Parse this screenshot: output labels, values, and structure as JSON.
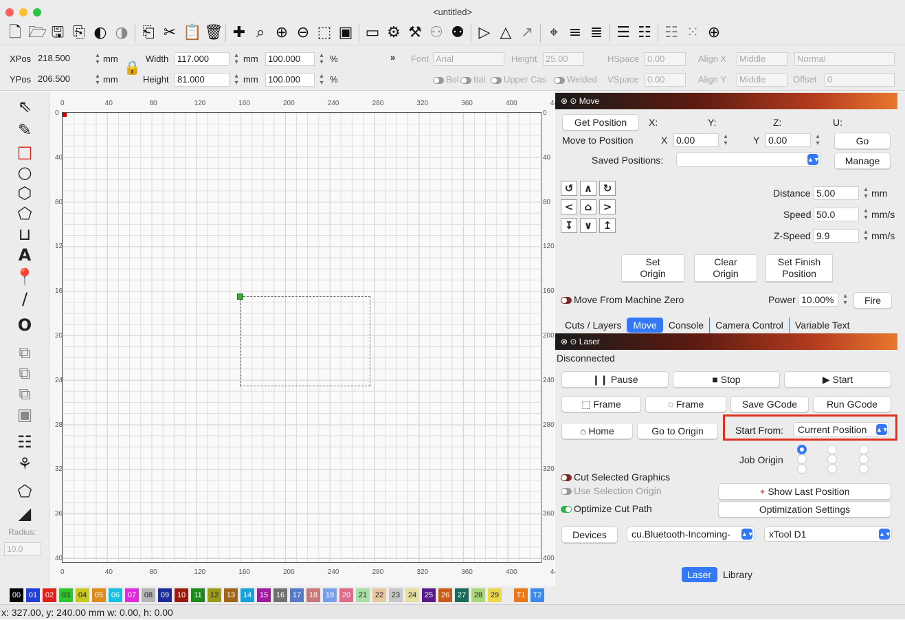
{
  "window": {
    "title": "<untitled>",
    "lights": [
      "#ff5f57",
      "#febc2e",
      "#28c840"
    ]
  },
  "toolbar": {
    "icons": [
      "new-file-icon",
      "open-folder-icon",
      "save-icon",
      "export-icon",
      "undo-icon",
      "redo-icon",
      "copy-icon",
      "cut-icon",
      "paste-icon",
      "delete-icon",
      "move-icon",
      "zoom-fit-icon",
      "zoom-in-icon",
      "zoom-out-icon",
      "frame-select-icon",
      "camera-icon",
      "monitor-icon",
      "settings-icon",
      "tools-icon",
      "group-icon",
      "user-icon",
      "mirror-h-icon",
      "mirror-v-icon",
      "rotate-icon",
      "target-icon",
      "align-icon",
      "distribute-icon",
      "align2-icon",
      "distribute2-icon",
      "array-icon",
      "crosshair-icon"
    ]
  },
  "props": {
    "xpos_label": "XPos",
    "xpos": "218.500",
    "xunit": "mm",
    "ypos_label": "YPos",
    "ypos": "206.500",
    "yunit": "mm",
    "width_label": "Width",
    "width": "117.000",
    "wunit": "mm",
    "height_label": "Height",
    "height": "81.000",
    "hunit": "mm",
    "wpct": "100.000",
    "hpct": "100.000",
    "pct": "%",
    "more": "»",
    "font_label": "Font",
    "font": "Arial",
    "theight_label": "Height",
    "theight": "25.00",
    "hspace_label": "HSpace",
    "hspace": "0.00",
    "vspace_label": "VSpace",
    "vspace": "0.00",
    "alignx_label": "Align X",
    "alignx": "Middle",
    "aligny_label": "Align Y",
    "aligny": "Middle",
    "normal": "Normal",
    "offset_label": "Offset",
    "offset": "0",
    "bold": "Bol",
    "italic": "Ital",
    "upper": "Upper Cas",
    "welded": "Welded"
  },
  "tools": {
    "radius_label": "Radius:",
    "radius": "10.0"
  },
  "rulers": {
    "x": [
      "0",
      "40",
      "80",
      "120",
      "160",
      "200",
      "240",
      "280",
      "320",
      "360",
      "400",
      "44"
    ],
    "y": [
      "0",
      "40",
      "80",
      "120",
      "160",
      "200",
      "240",
      "280",
      "320",
      "360",
      "400"
    ]
  },
  "move": {
    "title": "Move",
    "get_position": "Get Position",
    "x_label": "X:",
    "y_label": "Y:",
    "z_label": "Z:",
    "u_label": "U:",
    "move_to": "Move to Position",
    "mx_label": "X",
    "mx": "0.00",
    "my_label": "Y",
    "my": "0.00",
    "go": "Go",
    "saved_label": "Saved Positions:",
    "saved": "",
    "manage": "Manage",
    "distance_label": "Distance",
    "distance": "5.00",
    "distance_unit": "mm",
    "speed_label": "Speed",
    "speed": "50.0",
    "speed_unit": "mm/s",
    "zspeed_label": "Z-Speed",
    "zspeed": "9.9",
    "zspeed_unit": "mm/s",
    "set_origin_1": "Set",
    "set_origin_2": "Origin",
    "clear_origin_1": "Clear",
    "clear_origin_2": "Origin",
    "set_finish_1": "Set Finish",
    "set_finish_2": "Position",
    "from_zero": "Move From Machine Zero",
    "power_label": "Power",
    "power": "10.00%",
    "fire": "Fire"
  },
  "tabs": [
    "Cuts / Layers",
    "Move",
    "Console",
    "Camera Control",
    "Variable Text"
  ],
  "laser": {
    "title": "Laser",
    "status": "Disconnected",
    "pause": "Pause",
    "stop": "Stop",
    "start": "Start",
    "frame1": "Frame",
    "frame2": "Frame",
    "save_gcode": "Save GCode",
    "run_gcode": "Run GCode",
    "home": "Home",
    "go_origin": "Go to Origin",
    "start_from_label": "Start From:",
    "start_from": "Current Position",
    "job_origin_label": "Job Origin",
    "cut_selected": "Cut Selected Graphics",
    "use_sel_origin": "Use Selection Origin",
    "optimize": "Optimize Cut Path",
    "show_last": "Show Last Position",
    "opt_settings": "Optimization Settings",
    "devices": "Devices",
    "port": "cu.Bluetooth-Incoming-",
    "device": "xTool D1"
  },
  "bottom_tabs": [
    "Laser",
    "Library"
  ],
  "palette": [
    {
      "label": "00",
      "color": "#000000"
    },
    {
      "label": "01",
      "color": "#1f3fd8"
    },
    {
      "label": "02",
      "color": "#e0201a"
    },
    {
      "label": "03",
      "color": "#2ec82e"
    },
    {
      "label": "04",
      "color": "#c8c81e"
    },
    {
      "label": "05",
      "color": "#e08a1a"
    },
    {
      "label": "06",
      "color": "#18c0e0"
    },
    {
      "label": "07",
      "color": "#e02adc"
    },
    {
      "label": "08",
      "color": "#b4b4b4"
    },
    {
      "label": "09",
      "color": "#1e2c9a"
    },
    {
      "label": "10",
      "color": "#9a1a10"
    },
    {
      "label": "11",
      "color": "#1e8a1e"
    },
    {
      "label": "12",
      "color": "#9a9a18"
    },
    {
      "label": "13",
      "color": "#a0641a"
    },
    {
      "label": "14",
      "color": "#18a0d8"
    },
    {
      "label": "15",
      "color": "#a01aa0"
    },
    {
      "label": "16",
      "color": "#707070"
    },
    {
      "label": "17",
      "color": "#5a78c8"
    },
    {
      "label": "18",
      "color": "#c87878"
    },
    {
      "label": "19",
      "color": "#78a0e8"
    },
    {
      "label": "20",
      "color": "#e06a8a"
    },
    {
      "label": "21",
      "color": "#a8e0a8"
    },
    {
      "label": "22",
      "color": "#e8c8a0"
    },
    {
      "label": "23",
      "color": "#c8c8c8"
    },
    {
      "label": "24",
      "color": "#e8e0a0"
    },
    {
      "label": "25",
      "color": "#5a1a8a"
    },
    {
      "label": "26",
      "color": "#c85a1a"
    },
    {
      "label": "27",
      "color": "#1a6a5a"
    },
    {
      "label": "28",
      "color": "#a8d878"
    },
    {
      "label": "29",
      "color": "#e8d84a"
    },
    {
      "label": "T1",
      "color": "#e8781a"
    },
    {
      "label": "T2",
      "color": "#3a8ae8"
    }
  ],
  "status": "x: 327.00, y: 240.00 mm  w: 0.00, h: 0.00"
}
